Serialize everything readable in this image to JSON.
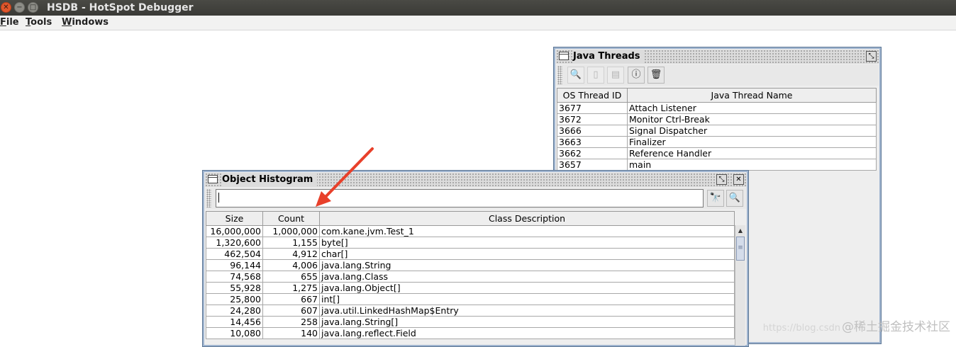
{
  "window": {
    "title": "HSDB - HotSpot Debugger"
  },
  "menu": [
    {
      "mnemonic": "F",
      "rest": "ile"
    },
    {
      "mnemonic": "T",
      "rest": "ools"
    },
    {
      "mnemonic": "W",
      "rest": "indows"
    }
  ],
  "java_threads": {
    "title": "Java Threads",
    "columns": [
      "OS Thread ID",
      "Java Thread Name"
    ],
    "rows": [
      [
        "3677",
        "Attach Listener"
      ],
      [
        "3672",
        "Monitor Ctrl-Break"
      ],
      [
        "3666",
        "Signal Dispatcher"
      ],
      [
        "3663",
        "Finalizer"
      ],
      [
        "3662",
        "Reference Handler"
      ],
      [
        "3657",
        "main"
      ]
    ]
  },
  "histogram": {
    "title": "Object Histogram",
    "search_value": "",
    "columns": [
      "Size",
      "Count",
      "Class Description"
    ],
    "rows": [
      [
        "16,000,000",
        "1,000,000",
        "com.kane.jvm.Test_1"
      ],
      [
        "1,320,600",
        "1,155",
        "byte[]"
      ],
      [
        "462,504",
        "4,912",
        "char[]"
      ],
      [
        "96,144",
        "4,006",
        "java.lang.String"
      ],
      [
        "74,568",
        "655",
        "java.lang.Class"
      ],
      [
        "55,928",
        "1,275",
        "java.lang.Object[]"
      ],
      [
        "25,800",
        "667",
        "int[]"
      ],
      [
        "24,280",
        "607",
        "java.util.LinkedHashMap$Entry"
      ],
      [
        "14,456",
        "258",
        "java.lang.String[]"
      ],
      [
        "10,080",
        "140",
        "java.lang.reflect.Field"
      ]
    ]
  },
  "annotation": {
    "color": "#e8402a"
  },
  "watermark": {
    "url": "https://blog.csdn",
    "text": "@稀土掘金技术社区"
  }
}
